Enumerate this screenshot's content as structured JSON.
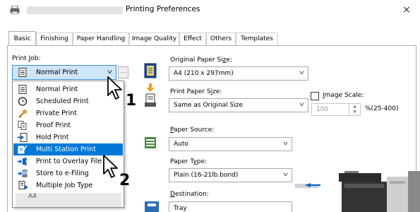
{
  "window": {
    "title": "Printing Preferences",
    "close_glyph": "×"
  },
  "tabs": [
    {
      "label": "Basic",
      "active": true
    },
    {
      "label": "Finishing",
      "active": false
    },
    {
      "label": "Paper Handling",
      "active": false
    },
    {
      "label": "Image Quality",
      "active": false
    },
    {
      "label": "Effect",
      "active": false
    },
    {
      "label": "Others",
      "active": false
    },
    {
      "label": "Templates",
      "active": false
    }
  ],
  "print_job": {
    "label_pre": "Print ",
    "label_u": "J",
    "label_post": "ob:",
    "value": "Normal Print",
    "more_button": "..."
  },
  "print_job_options": [
    {
      "label": "Normal Print",
      "icon": "document-icon"
    },
    {
      "label": "Scheduled Print",
      "icon": "clock-icon"
    },
    {
      "label": "Private Print",
      "icon": "key-icon"
    },
    {
      "label": "Proof Print",
      "icon": "proof-icon"
    },
    {
      "label": "Hold Print",
      "icon": "hold-icon"
    },
    {
      "label": "Multi Station Print",
      "icon": "multi-station-icon",
      "selected": true
    },
    {
      "label": "Print to Overlay File",
      "icon": "overlay-icon"
    },
    {
      "label": "Store to e-Filing",
      "icon": "efiling-icon"
    },
    {
      "label": "Multiple Job Type",
      "icon": "multiple-job-icon"
    }
  ],
  "list_partial_item": "A4",
  "original_paper_size": {
    "label_pre": "Original Paper Si",
    "label_u": "z",
    "label_post": "e:",
    "value": "A4 (210 x 297mm)"
  },
  "print_paper_size": {
    "label_pre": "Print Paper S",
    "label_u": "i",
    "label_post": "ze:",
    "value": "Same as Original Size"
  },
  "image_scale": {
    "label_pre": "",
    "label_u": "I",
    "label_post": "mage Scale:",
    "value": "100",
    "range": "%(25-400)"
  },
  "paper_source": {
    "label_pre": "",
    "label_u": "P",
    "label_post": "aper Source:",
    "value": "Auto"
  },
  "paper_type": {
    "label_pre": "Paper T",
    "label_u": "y",
    "label_post": "pe:",
    "value": "Plain (16-21lb.bond)"
  },
  "destination": {
    "label_pre": "",
    "label_u": "D",
    "label_post": "estination:",
    "value": "Tray"
  },
  "steps": {
    "one": "1",
    "two": "2"
  },
  "colors": {
    "accent": "#0078d7",
    "combo_highlight": "#cfe5f9",
    "combo_highlight_border": "#3c8ee0",
    "orange_arrow": "#f0a020"
  }
}
